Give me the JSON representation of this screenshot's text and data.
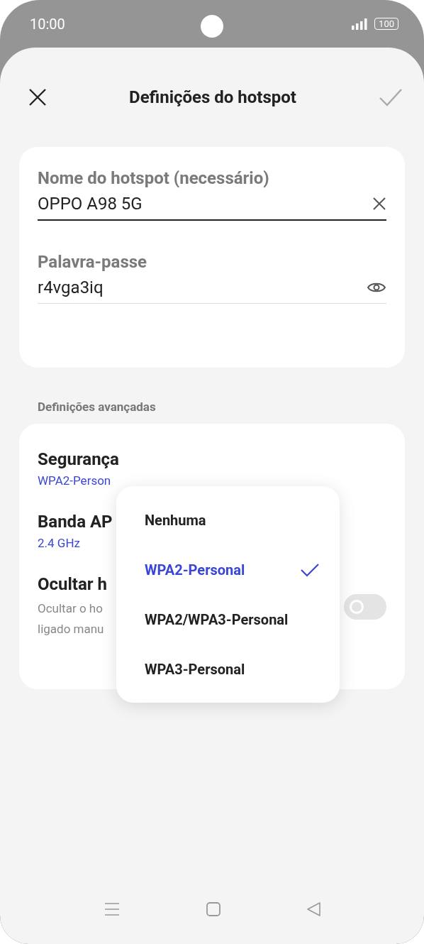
{
  "status_bar": {
    "time": "10:00",
    "battery": "100"
  },
  "header": {
    "title": "Definições do hotspot"
  },
  "hotspot_card": {
    "fields": [
      {
        "label": "Nome do hotspot (necessário)",
        "value": "OPPO A98 5G",
        "focused": true,
        "kind": "clear"
      },
      {
        "label": "Palavra-passe",
        "value": "r4vga3iq",
        "focused": false,
        "kind": "reveal"
      }
    ]
  },
  "advanced": {
    "heading": "Definições avançadas",
    "rows": [
      {
        "kind": "value",
        "title": "Segurança",
        "value": "WPA2-Person"
      },
      {
        "kind": "value",
        "title": "Banda AP",
        "value": "2.4 GHz"
      },
      {
        "kind": "toggle",
        "title": "Ocultar h",
        "description": [
          "Ocultar o ho",
          "ligado manu"
        ],
        "on": false
      }
    ]
  },
  "security_menu": {
    "options": [
      {
        "label": "Nenhuma",
        "selected": false
      },
      {
        "label": "WPA2-Personal",
        "selected": true
      },
      {
        "label": "WPA2/WPA3-Personal",
        "selected": false
      },
      {
        "label": "WPA3-Personal",
        "selected": false
      }
    ]
  }
}
